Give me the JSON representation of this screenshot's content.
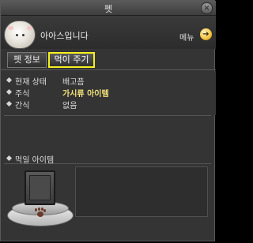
{
  "window": {
    "title": "펫",
    "close_glyph": "×"
  },
  "header": {
    "pet_name": "아아스입니다",
    "menu_label": "메뉴",
    "menu_glyph": "➔"
  },
  "tabs": [
    {
      "label": "펫 정보",
      "selected": false
    },
    {
      "label": "먹이 주기",
      "selected": true
    }
  ],
  "status": {
    "rows": [
      {
        "label": "현재 상태",
        "value": "배고픔"
      },
      {
        "label": "주식",
        "value": "가시류 아이템"
      },
      {
        "label": "간식",
        "value": "없음"
      }
    ]
  },
  "feed": {
    "label": "먹일 아이템"
  },
  "colors": {
    "selected_tab_outline": "#f4f020",
    "highlight_value": "#f2e27a"
  },
  "icons": {
    "portrait": "sheep-pet-portrait",
    "menu": "arrow-right-icon",
    "feed_bowl": "pet-bowl-paw-icon"
  }
}
